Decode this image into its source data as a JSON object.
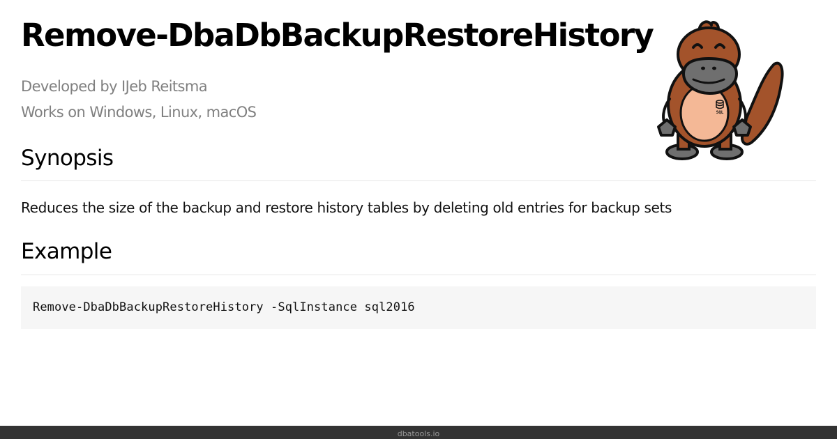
{
  "page": {
    "title": "Remove-DbaDbBackupRestoreHistory",
    "developed_by": "Developed by IJeb Reitsma",
    "works_on": "Works on Windows, Linux, macOS"
  },
  "synopsis": {
    "heading": "Synopsis",
    "text": "Reduces the size of the backup and restore history tables by deleting old entries for backup sets"
  },
  "example": {
    "heading": "Example",
    "code": "Remove-DbaDbBackupRestoreHistory -SqlInstance sql2016"
  },
  "mascot": {
    "icon": "platypus-mascot-icon",
    "badge_text": "SQL"
  },
  "footer": {
    "text": "dbatools.io"
  },
  "colors": {
    "mascot_brown": "#a3532b",
    "mascot_belly": "#f4b896",
    "mascot_bill": "#6f6f6f",
    "footer_bg": "#333333"
  }
}
